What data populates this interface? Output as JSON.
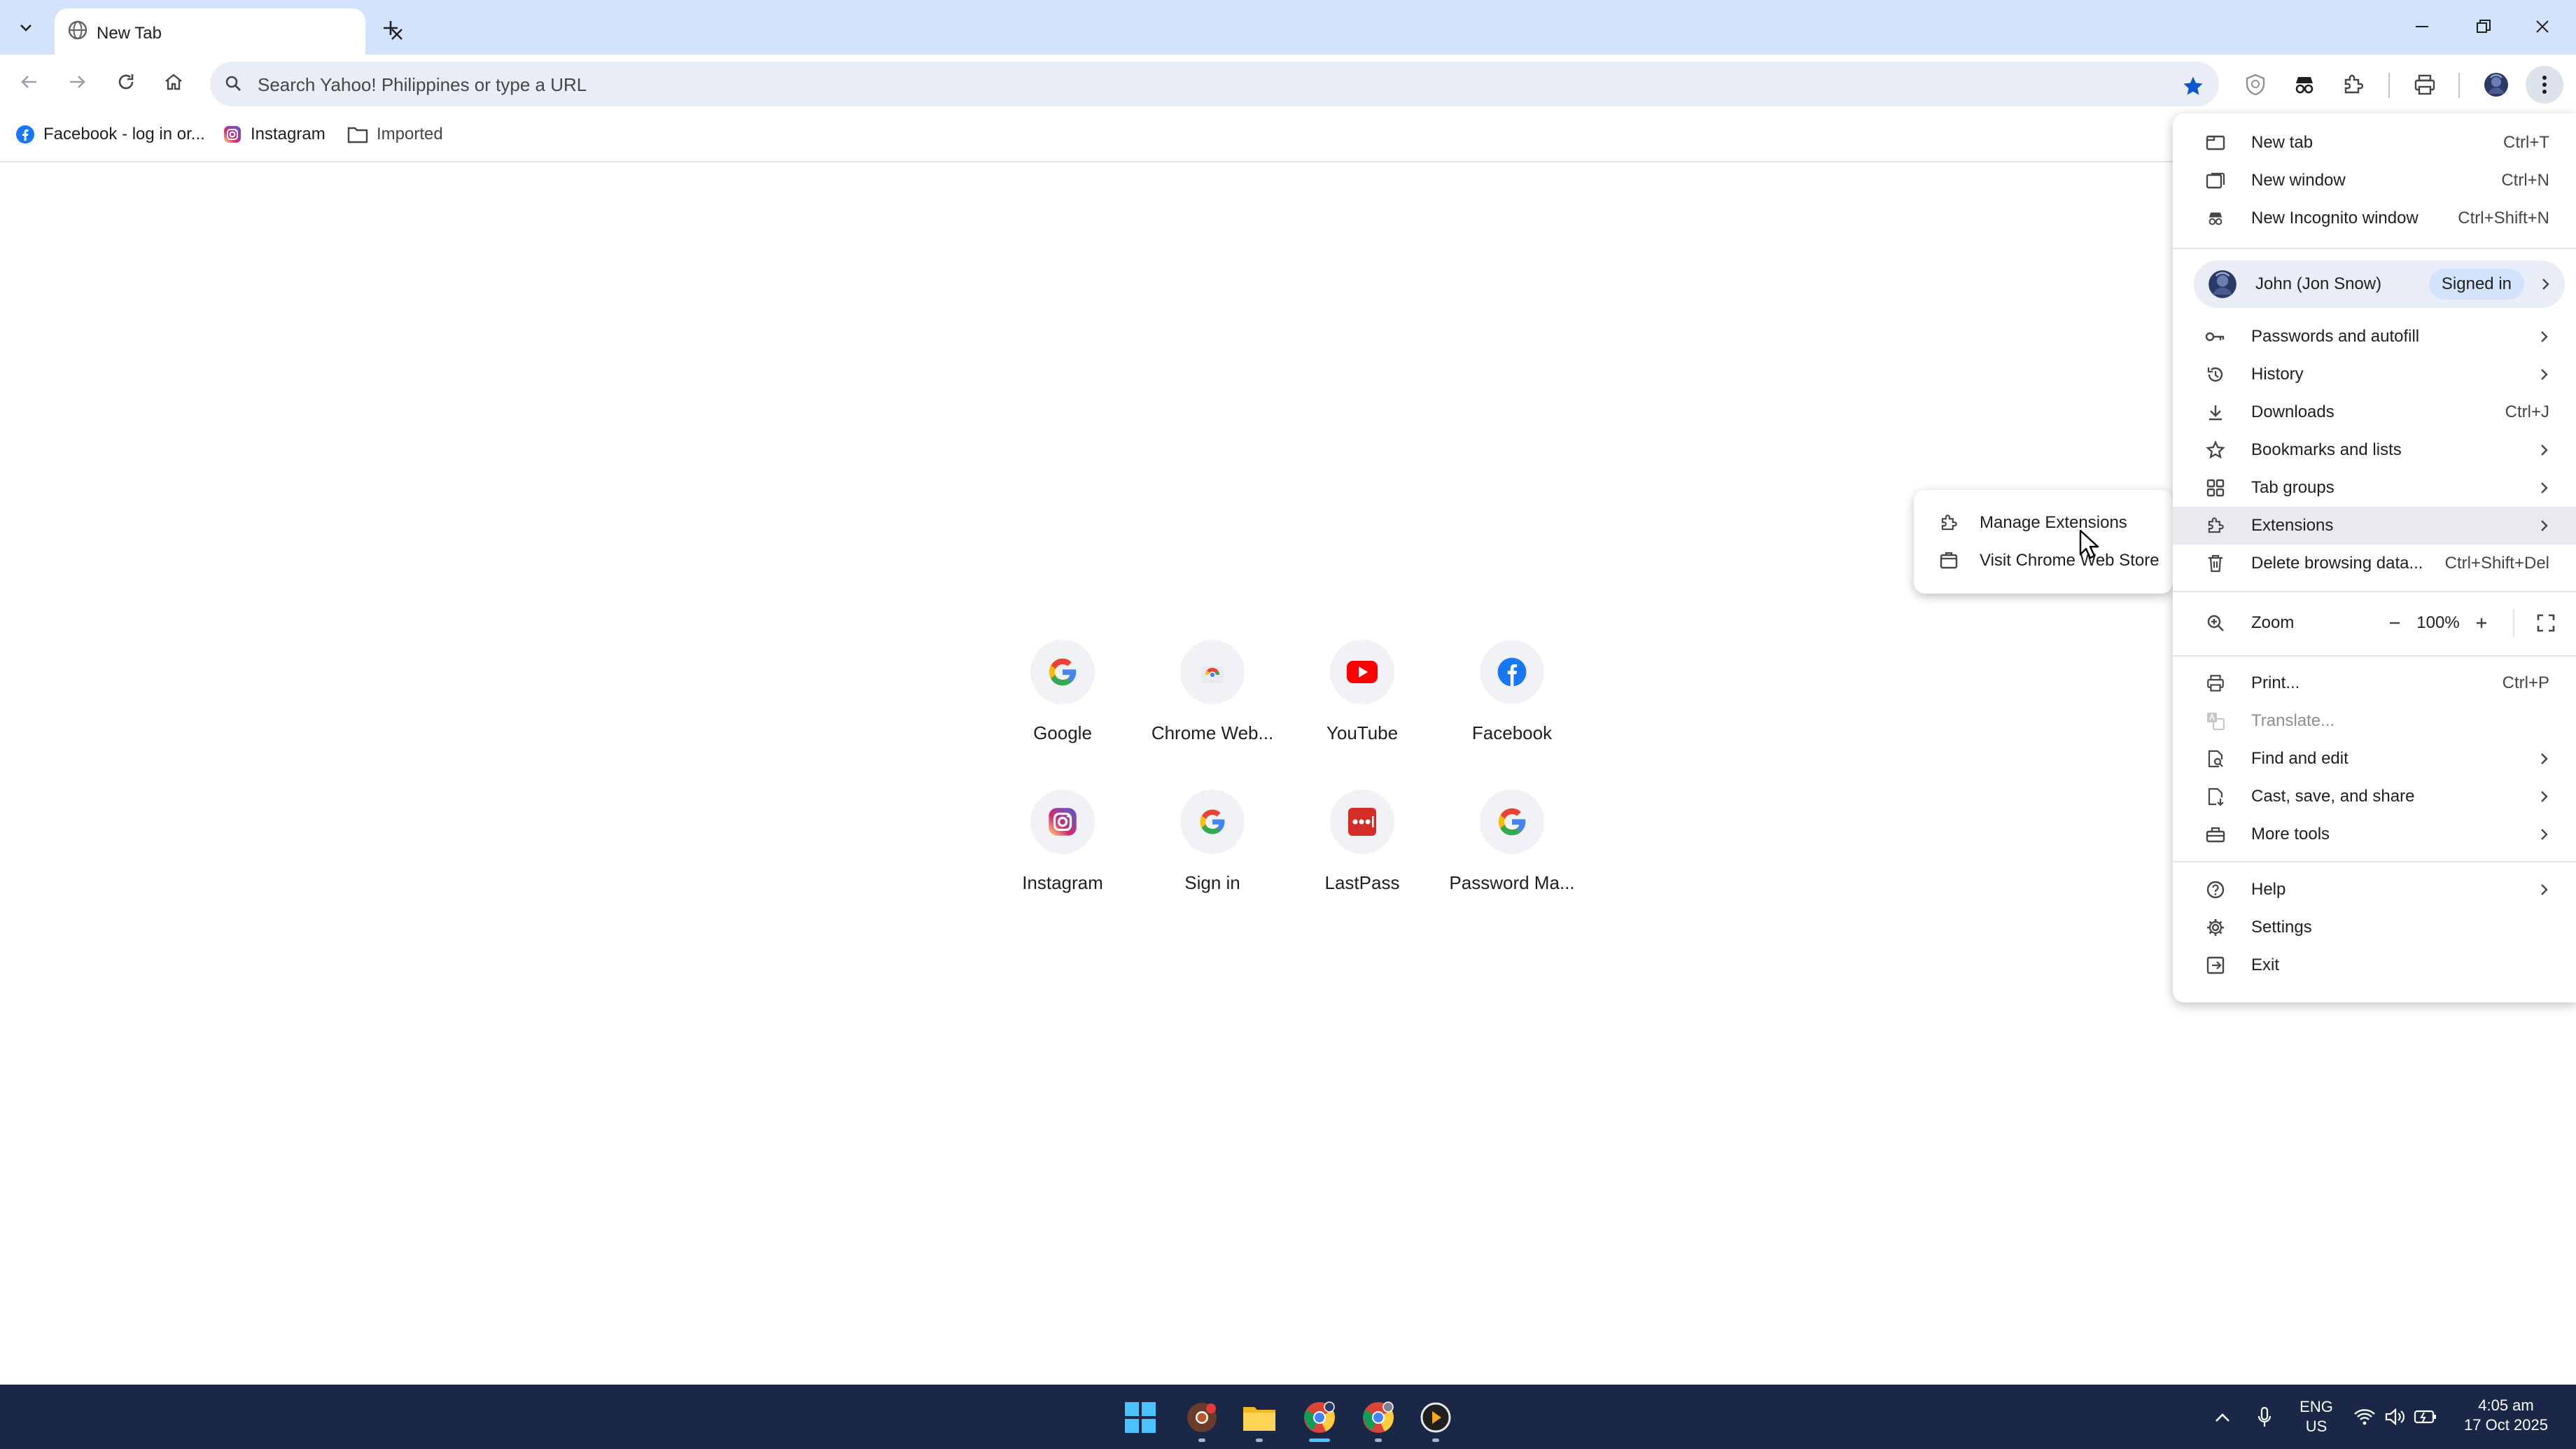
{
  "tab": {
    "title": "New Tab"
  },
  "omnibox": {
    "placeholder": "Search Yahoo! Philippines or type a URL"
  },
  "bookmarks": [
    {
      "label": "Facebook - log in or..."
    },
    {
      "label": "Instagram"
    },
    {
      "label": "Imported"
    }
  ],
  "shortcuts": [
    {
      "label": "Google"
    },
    {
      "label": "Chrome Web..."
    },
    {
      "label": "YouTube"
    },
    {
      "label": "Facebook"
    },
    {
      "label": "Instagram"
    },
    {
      "label": "Sign in"
    },
    {
      "label": "LastPass"
    },
    {
      "label": "Password Ma..."
    }
  ],
  "menu": {
    "new_tab": {
      "label": "New tab",
      "shortcut": "Ctrl+T"
    },
    "new_window": {
      "label": "New window",
      "shortcut": "Ctrl+N"
    },
    "new_incognito": {
      "label": "New Incognito window",
      "shortcut": "Ctrl+Shift+N"
    },
    "profile": {
      "name": "John (Jon Snow)",
      "status": "Signed in"
    },
    "passwords": {
      "label": "Passwords and autofill"
    },
    "history": {
      "label": "History"
    },
    "downloads": {
      "label": "Downloads",
      "shortcut": "Ctrl+J"
    },
    "bookmarks": {
      "label": "Bookmarks and lists"
    },
    "tab_groups": {
      "label": "Tab groups"
    },
    "extensions": {
      "label": "Extensions"
    },
    "delete_data": {
      "label": "Delete browsing data...",
      "shortcut": "Ctrl+Shift+Del"
    },
    "zoom": {
      "label": "Zoom",
      "value": "100%"
    },
    "print": {
      "label": "Print...",
      "shortcut": "Ctrl+P"
    },
    "translate": {
      "label": "Translate..."
    },
    "find_edit": {
      "label": "Find and edit"
    },
    "cast": {
      "label": "Cast, save, and share"
    },
    "more_tools": {
      "label": "More tools"
    },
    "help": {
      "label": "Help"
    },
    "settings": {
      "label": "Settings"
    },
    "exit": {
      "label": "Exit"
    }
  },
  "submenu": {
    "manage": {
      "label": "Manage Extensions"
    },
    "store": {
      "label": "Visit Chrome Web Store"
    }
  },
  "taskbar": {
    "language": "ENG",
    "region": "US",
    "time": "4:05 am",
    "date": "17 Oct 2025"
  },
  "colors": {
    "tabstrip": "#d3e3fd",
    "omnibox": "#e9eef6",
    "taskbar": "#1a2747",
    "accent": "#0b57d0"
  }
}
